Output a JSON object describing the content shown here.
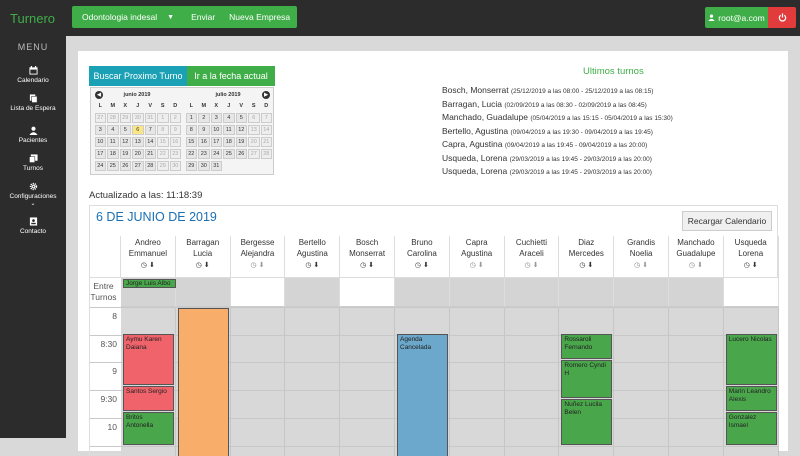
{
  "topbar": {
    "brand": "Turnero",
    "clinic": "Odontologia indesal",
    "send": "Enviar",
    "new_company": "Nueva Empresa",
    "user": "root@a.com"
  },
  "sidebar": {
    "menu": "MENU",
    "items": [
      {
        "label": "Calendario",
        "icon": "calendar-icon"
      },
      {
        "label": "Lista de Espera",
        "icon": "file-copy-icon"
      },
      {
        "label": "Pacientes",
        "icon": "user-icon"
      },
      {
        "label": "Turnos",
        "icon": "copy-icon"
      },
      {
        "label": "Configuraciones",
        "icon": "gear-icon"
      },
      {
        "label": "Contacto",
        "icon": "contact-card-icon"
      }
    ]
  },
  "search_next": "Buscar Proximo Turno",
  "go_to_date": "Ir a la fecha actual",
  "calendar": {
    "months": [
      {
        "name": "junio 2019",
        "dow": [
          "L",
          "M",
          "X",
          "J",
          "V",
          "S",
          "D"
        ],
        "days": [
          [
            "27",
            "28",
            "29",
            "30",
            "31",
            "1",
            "2"
          ],
          [
            "3",
            "4",
            "5",
            "6",
            "7",
            "8",
            "9"
          ],
          [
            "10",
            "11",
            "12",
            "13",
            "14",
            "15",
            "16"
          ],
          [
            "17",
            "18",
            "19",
            "20",
            "21",
            "22",
            "23"
          ],
          [
            "24",
            "25",
            "26",
            "27",
            "28",
            "29",
            "30"
          ]
        ]
      },
      {
        "name": "julio 2019",
        "dow": [
          "L",
          "M",
          "X",
          "J",
          "V",
          "S",
          "D"
        ],
        "days": [
          [
            "1",
            "2",
            "3",
            "4",
            "5",
            "6",
            "7"
          ],
          [
            "8",
            "9",
            "10",
            "11",
            "12",
            "13",
            "14"
          ],
          [
            "15",
            "16",
            "17",
            "18",
            "19",
            "20",
            "21"
          ],
          [
            "22",
            "23",
            "24",
            "25",
            "26",
            "27",
            "28"
          ],
          [
            "29",
            "30",
            "31",
            "",
            "",
            "",
            ""
          ]
        ]
      }
    ]
  },
  "updated": "Actualizado a las: 11:18:39",
  "last_appointments": {
    "title": "Ultimos turnos",
    "items": [
      {
        "name": "Bosch, Monserrat",
        "range": "(25/12/2019 a las 08:00 - 25/12/2019 a las 08:15)"
      },
      {
        "name": "Barragan, Lucia",
        "range": "(02/09/2019 a las 08:30 - 02/09/2019 a las 08:45)"
      },
      {
        "name": "Manchado, Guadalupe",
        "range": "(05/04/2019 a las 15:15 - 05/04/2019 a las 15:30)"
      },
      {
        "name": "Bertello, Agustina",
        "range": "(09/04/2019 a las 19:30 - 09/04/2019 a las 19:45)"
      },
      {
        "name": "Capra, Agustina",
        "range": "(09/04/2019 a las 19:45 - 09/04/2019 a las 20:00)"
      },
      {
        "name": "Usqueda, Lorena",
        "range": "(29/03/2019 a las 19:45 - 29/03/2019 a las 20:00)"
      },
      {
        "name": "Usqueda, Lorena",
        "range": "(29/03/2019 a las 19:45 - 29/03/2019 a las 20:00)"
      }
    ]
  },
  "schedule": {
    "date": "6 DE JUNIO DE 2019",
    "reload": "Recargar Calendario",
    "entre_label": "Entre\nTurnos",
    "entre_event": "Jorge Luis Albo",
    "times": [
      "8",
      "8:30",
      "9",
      "9:30",
      "10"
    ],
    "professionals": [
      {
        "first": "Andreo",
        "second": "Emmanuel"
      },
      {
        "first": "Barragan",
        "second": "Lucia"
      },
      {
        "first": "Bergesse",
        "second": "Alejandra"
      },
      {
        "first": "Bertello",
        "second": "Agustina"
      },
      {
        "first": "Bosch",
        "second": "Monserrat"
      },
      {
        "first": "Bruno",
        "second": "Carolina"
      },
      {
        "first": "Capra",
        "second": "Agustina"
      },
      {
        "first": "Cuchietti",
        "second": "Araceli"
      },
      {
        "first": "Diaz",
        "second": "Mercedes"
      },
      {
        "first": "Grandis",
        "second": "Noelia"
      },
      {
        "first": "Manchado",
        "second": "Guadalupe"
      },
      {
        "first": "Usqueda",
        "second": "Lorena"
      }
    ],
    "appointments": [
      {
        "text": "Aymu Karen Daiana"
      },
      {
        "text": "Santos Sergio"
      },
      {
        "text": "Britos Antonella"
      },
      {
        "text": ""
      },
      {
        "text": "Agenda Cancelada"
      },
      {
        "text": "Rossaroli Fernando"
      },
      {
        "text": "Romero Cyndi H"
      },
      {
        "text": "Nuñez Lucila Belen"
      },
      {
        "text": "Lucero Nicolas"
      },
      {
        "text": "Marin Leandro Alexis"
      },
      {
        "text": "Gonzalez Ismael"
      }
    ]
  },
  "colors": {
    "green": "#3fae49",
    "teal": "#1aa1b5",
    "red": "#e23b3b",
    "appt_red": "#f0636b",
    "appt_orange": "#f8ad6a",
    "appt_blue": "#6ba8cb",
    "appt_green": "#4aa64b"
  }
}
